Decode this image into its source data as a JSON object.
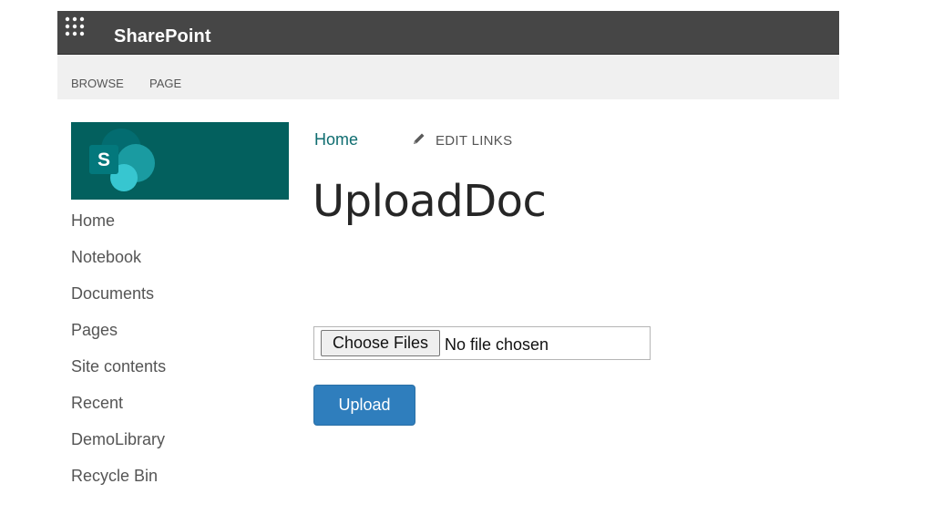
{
  "suitebar": {
    "app_title": "SharePoint",
    "waffle_icon": "app-launcher-icon",
    "background": "#464646"
  },
  "ribbon": {
    "tabs": [
      "BROWSE",
      "PAGE"
    ]
  },
  "site_logo": {
    "icon": "sharepoint-logo-icon",
    "letter": "S",
    "background": "#03605e"
  },
  "quicklaunch": {
    "items": [
      "Home",
      "Notebook",
      "Documents",
      "Pages",
      "Site contents",
      "Recent",
      "DemoLibrary",
      "Recycle Bin"
    ]
  },
  "topnav": {
    "home_label": "Home",
    "edit_links_icon": "pencil-icon",
    "edit_links_label": "EDIT LINKS"
  },
  "page": {
    "title": "UploadDoc"
  },
  "form": {
    "choose_label": "Choose Files",
    "file_status": "No file chosen",
    "upload_label": "Upload",
    "upload_color": "#2f7ebd"
  }
}
